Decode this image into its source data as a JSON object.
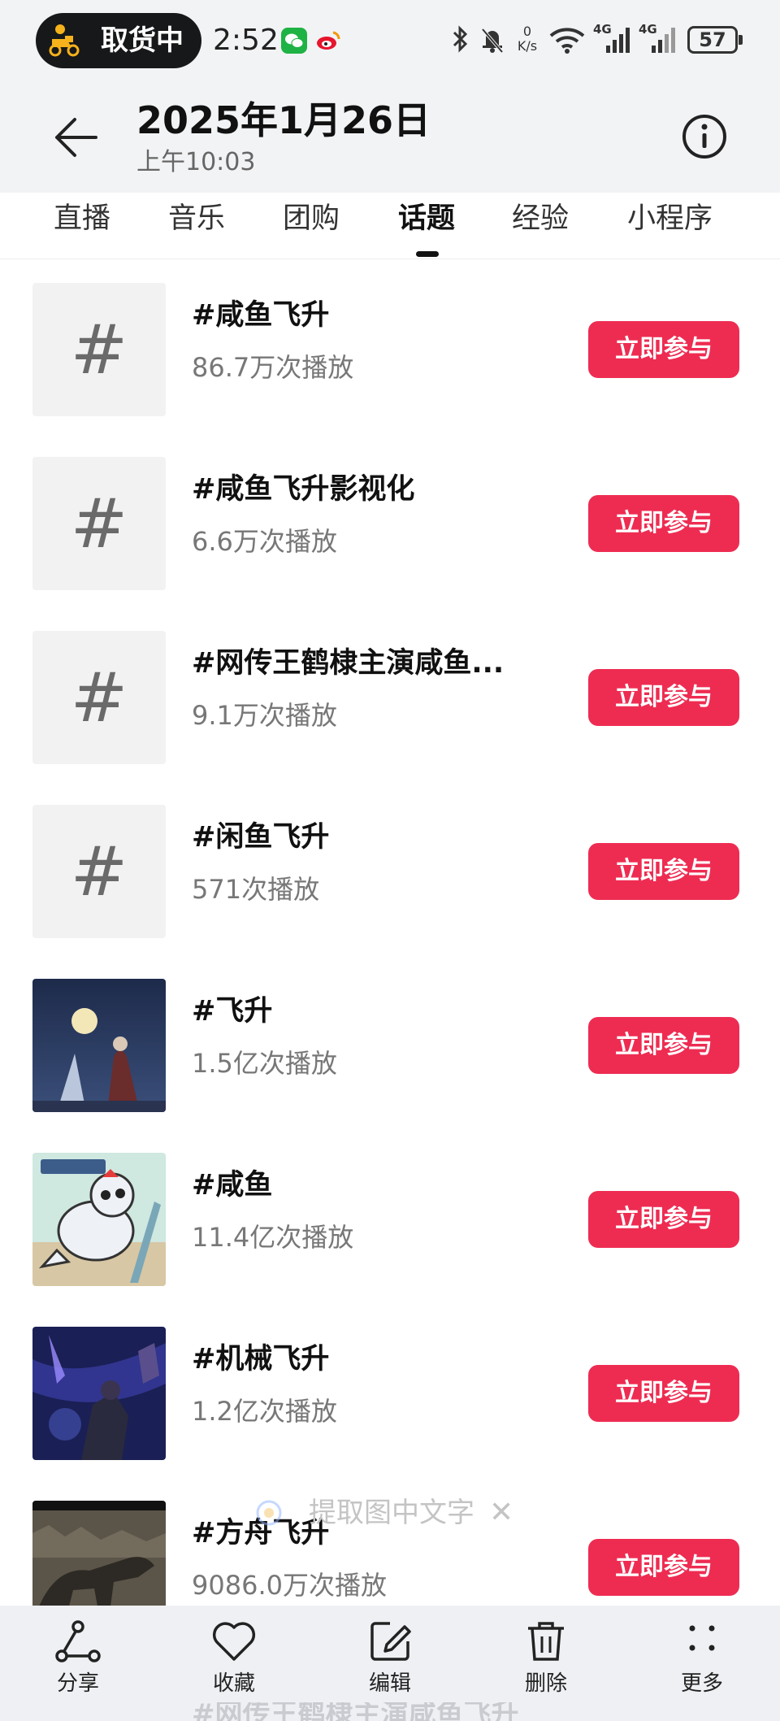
{
  "status_bar": {
    "pill_label": "取货中",
    "time": "2:52",
    "net_speed_value": "0",
    "net_speed_unit": "K/s",
    "signal_1": "4G",
    "signal_2": "4G",
    "battery": "57"
  },
  "header": {
    "title": "2025年1月26日",
    "subtitle": "上午10:03"
  },
  "tabs": [
    {
      "label": "直播"
    },
    {
      "label": "音乐"
    },
    {
      "label": "团购"
    },
    {
      "label": "话题",
      "active": true
    },
    {
      "label": "经验"
    },
    {
      "label": "小程序"
    }
  ],
  "topics": [
    {
      "title": "#咸鱼飞升",
      "plays": "86.7万次播放",
      "action": "立即参与",
      "thumb": "hash-icon"
    },
    {
      "title": "#咸鱼飞升影视化",
      "plays": "6.6万次播放",
      "action": "立即参与",
      "thumb": "hash-icon"
    },
    {
      "title": "#网传王鹤棣主演咸鱼...",
      "plays": "9.1万次播放",
      "action": "立即参与",
      "thumb": "hash-icon"
    },
    {
      "title": "#闲鱼飞升",
      "plays": "571次播放",
      "action": "立即参与",
      "thumb": "hash-icon"
    },
    {
      "title": "#飞升",
      "plays": "1.5亿次播放",
      "action": "立即参与",
      "thumb": "moon-night-image"
    },
    {
      "title": "#咸鱼",
      "plays": "11.4亿次播放",
      "action": "立即参与",
      "thumb": "cartoon-fish-image"
    },
    {
      "title": "#机械飞升",
      "plays": "1.2亿次播放",
      "action": "立即参与",
      "thumb": "purple-game-image"
    },
    {
      "title": "#方舟飞升",
      "plays": "9086.0万次播放",
      "action": "立即参与",
      "thumb": "dinosaur-image"
    }
  ],
  "hash_glyph": "#",
  "ocr_tip": {
    "label": "提取图中文字",
    "close": "✕"
  },
  "toolbar": [
    {
      "label": "分享",
      "icon": "share-icon"
    },
    {
      "label": "收藏",
      "icon": "heart-icon"
    },
    {
      "label": "编辑",
      "icon": "edit-icon"
    },
    {
      "label": "删除",
      "icon": "trash-icon"
    },
    {
      "label": "更多",
      "icon": "more-icon"
    }
  ],
  "peek_text": "#网传王鹤棣主演咸鱼飞升",
  "colors": {
    "accent": "#ee2c52",
    "header_bg": "#f2f3f5",
    "toolbar_bg": "#eef0f3",
    "text_primary": "#111111",
    "text_secondary": "#777777"
  }
}
